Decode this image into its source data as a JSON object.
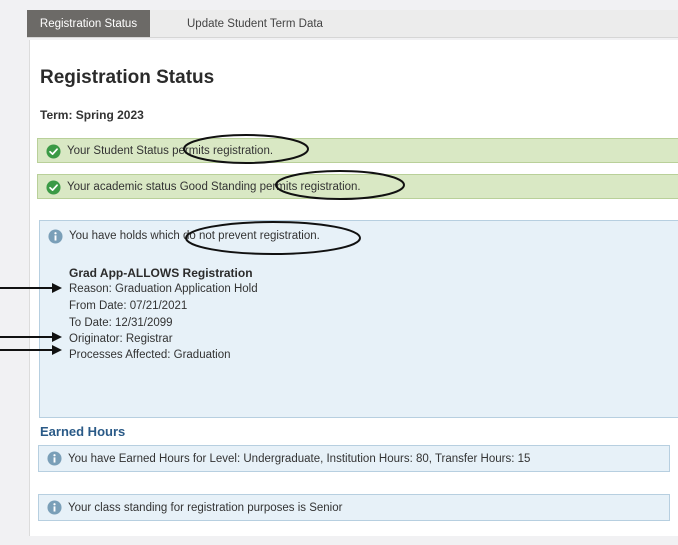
{
  "tabs": [
    {
      "label": "Registration Status",
      "active": true
    },
    {
      "label": "Update Student Term Data",
      "active": false
    }
  ],
  "page": {
    "title": "Registration Status",
    "term": "Term: Spring 2023"
  },
  "status_messages": [
    {
      "text": "Your Student Status permits registration.",
      "icon": "check-circle-icon"
    },
    {
      "text": "Your academic status Good Standing permits registration.",
      "icon": "check-circle-icon"
    }
  ],
  "holds": {
    "summary": "You have holds which do not prevent registration.",
    "name": "Grad App-ALLOWS Registration",
    "reason": "Reason: Graduation Application Hold",
    "from_date": "From Date: 07/21/2021",
    "to_date": "To Date: 12/31/2099",
    "originator": "Originator: Registrar",
    "processes": "Processes Affected: Graduation"
  },
  "earned_hours": {
    "heading": "Earned Hours",
    "message": "You have Earned Hours for Level: Undergraduate, Institution Hours: 80, Transfer Hours: 15"
  },
  "class_standing": {
    "message": "Your class standing for registration purposes is Senior"
  },
  "colors": {
    "success_bg": "#d9e8c4",
    "success_icon": "#3b9a46",
    "info_bg": "#e7f1f8",
    "info_icon": "#7a9fb8",
    "section_heading": "#2a5a87",
    "active_tab": "#6c6a67"
  }
}
